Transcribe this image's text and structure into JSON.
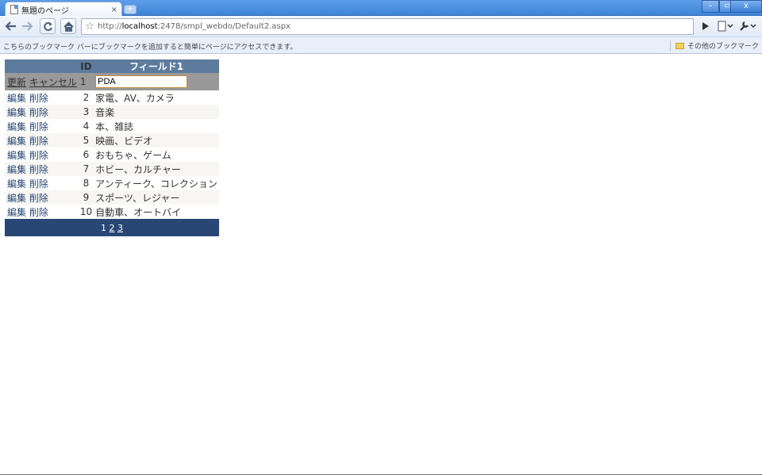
{
  "window": {
    "tab_title": "無題のページ",
    "tab_close": "×",
    "new_tab": "+",
    "controls": [
      "–",
      "▭",
      "x"
    ]
  },
  "toolbar": {
    "back_icon": "back-arrow-icon",
    "forward_icon": "forward-arrow-icon",
    "url_prefix": "http://",
    "url_host": "localhost",
    "url_rest": ":2478/smpl_webdo/Default2.aspx"
  },
  "bookmarks": {
    "hint": "こちらのブックマーク バーにブックマークを追加すると簡単にページにアクセスできます。",
    "other": "その他のブックマーク"
  },
  "grid": {
    "headers": {
      "command": "",
      "id": "ID",
      "field1": "フィールド1"
    },
    "edit_row": {
      "update": "更新",
      "cancel": "キャンセル",
      "id": "1",
      "value": "PDA"
    },
    "edit_label": "編集",
    "delete_label": "削除",
    "rows": [
      {
        "id": "2",
        "field1": "家電、AV、カメラ"
      },
      {
        "id": "3",
        "field1": "音楽"
      },
      {
        "id": "4",
        "field1": "本、雑誌"
      },
      {
        "id": "5",
        "field1": "映画、ビデオ"
      },
      {
        "id": "6",
        "field1": "おもちゃ、ゲーム"
      },
      {
        "id": "7",
        "field1": "ホビー、カルチャー"
      },
      {
        "id": "8",
        "field1": "アンティーク、コレクション"
      },
      {
        "id": "9",
        "field1": "スポーツ、レジャー"
      },
      {
        "id": "10",
        "field1": "自動車、オートバイ"
      }
    ],
    "pager": {
      "current": "1",
      "pages": [
        "2",
        "3"
      ]
    }
  },
  "colors": {
    "header": "#5d7b9d",
    "pager": "#284775",
    "edit_row": "#999999",
    "alt_row": "#f7f6f3"
  }
}
